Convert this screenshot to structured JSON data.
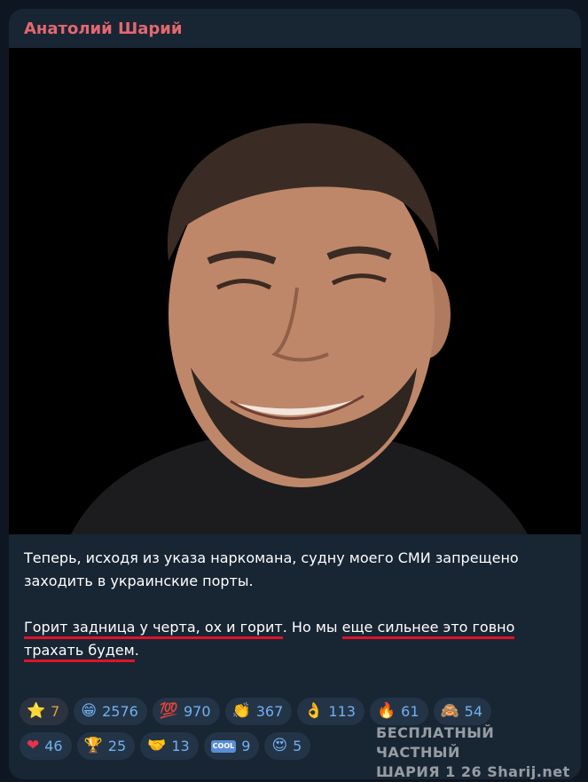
{
  "post": {
    "author": "Анатолий Шарий",
    "paragraph1": "Теперь, исходя из указа наркомана, судну моего СМИ запрещено заходить в украинские порты.",
    "p2_part1": "Горит задница у черта, ох и горит",
    "p2_part2": ". Но мы ",
    "p2_part3": "еще сильнее это говно",
    "p2_part4": " ",
    "p2_part5": "трахать будем",
    "p2_part6": "."
  },
  "reactions": [
    {
      "icon": "star-icon",
      "glyph": "⭐",
      "count": "7"
    },
    {
      "icon": "grin-icon",
      "glyph": "😁",
      "count": "2576"
    },
    {
      "icon": "hundred-icon",
      "glyph": "💯",
      "count": "970"
    },
    {
      "icon": "clap-icon",
      "glyph": "👏",
      "count": "367"
    },
    {
      "icon": "ok-hand-icon",
      "glyph": "👌",
      "count": "113"
    },
    {
      "icon": "fire-icon",
      "glyph": "🔥",
      "count": "61"
    },
    {
      "icon": "monkey-icon",
      "glyph": "🙈",
      "count": "54"
    },
    {
      "icon": "heart-icon",
      "glyph": "❤",
      "count": "46"
    },
    {
      "icon": "trophy-icon",
      "glyph": "🏆",
      "count": "25"
    },
    {
      "icon": "handshake-icon",
      "glyph": "🤝",
      "count": "13"
    },
    {
      "icon": "cool-icon",
      "glyph": "COOL",
      "count": "9"
    },
    {
      "icon": "heart-eyes-icon",
      "glyph": "😍",
      "count": "5"
    }
  ],
  "watermark": {
    "line1": "БЕСПЛАТНЫЙ ЧАСТНЫЙ",
    "line2": "ШАРИЯ 1 26 Sharij.net"
  },
  "colors": {
    "background": "#0e1621",
    "bubble": "#182533",
    "author": "#e36870",
    "underline": "#e0122a",
    "reaction_text": "#6fb1f0"
  }
}
